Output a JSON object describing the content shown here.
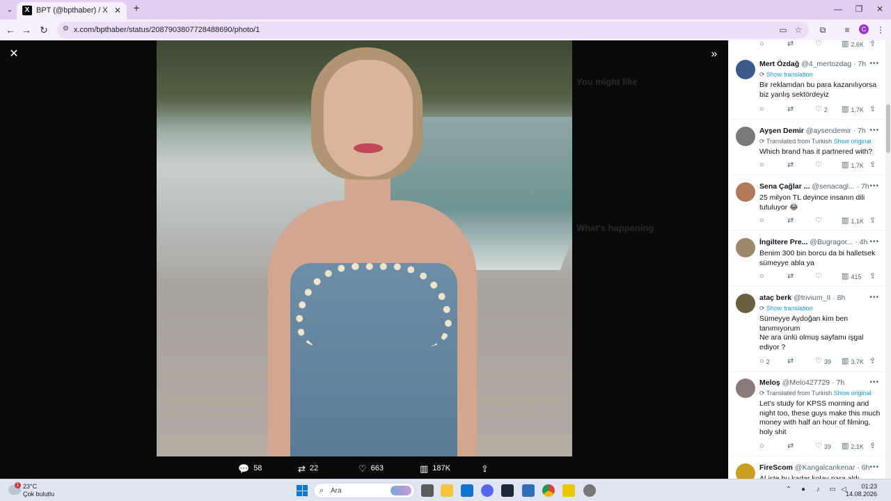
{
  "browser": {
    "tab_title": "BPT (@bpthaber) / X",
    "tab_favicon": "X",
    "url": "x.com/bpthaber/status/2087903807728488690/photo/1",
    "profile_initial": "C"
  },
  "backdrop": {
    "you_might_like": "You might like",
    "whats_happening": "What's happening"
  },
  "media_actions": {
    "replies": "58",
    "reposts": "22",
    "likes": "663",
    "views": "187K"
  },
  "replies": [
    {
      "name": "Mert Özdağ",
      "handle": "@4_mertozdag",
      "time": "· 7h",
      "translation": "Show translation",
      "translation_type": "show",
      "text": "Bir reklamdan bu para kazanılıyorsa biz yanlış sektördeyiz",
      "replies": "",
      "reposts": "",
      "likes": "2",
      "views": "1.7K",
      "avatar_color": "#3b5a8a"
    },
    {
      "name": "Ayşen Demir",
      "handle": "@aysendemir",
      "time": "· 7h",
      "translation": "Translated from Turkish",
      "translation_link": "Show original",
      "translation_type": "translated",
      "text": "Which brand has it partnered with?",
      "replies": "",
      "reposts": "",
      "likes": "",
      "views": "1.7K",
      "avatar_color": "#7a7a7a"
    },
    {
      "name": "Sena Çağlar ...",
      "handle": "@senacagl...",
      "time": "· 7h",
      "translation": "",
      "translation_type": "none",
      "text": "25 milyon TL deyince insanın dili tutuluyor 😂",
      "replies": "",
      "reposts": "",
      "likes": "",
      "views": "1.1K",
      "avatar_color": "#b07a5a"
    },
    {
      "name": "İngiltere Pre...",
      "handle": "@Bugragor...",
      "time": "· 4h",
      "translation": "",
      "translation_type": "none",
      "text": "Benim 300 bin borcu da bi halletsek sümeyye abla ya",
      "replies": "",
      "reposts": "",
      "likes": "",
      "views": "415",
      "avatar_color": "#9a8a6a"
    },
    {
      "name": "ataç berk",
      "handle": "@trivium_II",
      "time": "· 8h",
      "translation": "Show translation",
      "translation_type": "show",
      "text": "Sümeyye Aydoğan kim ben tanımıyorum\nNe ara ünlü olmuş sayfamı işgal ediyor ?",
      "replies": "2",
      "reposts": "",
      "likes": "39",
      "views": "3.7K",
      "avatar_color": "#6a6040"
    },
    {
      "name": "Meloş",
      "handle": "@Melo427729",
      "time": "· 7h",
      "translation": "Translated from Turkish",
      "translation_link": "Show original",
      "translation_type": "translated",
      "text": "Let's study for KPSS morning and night too, these guys make this much money with half an hour of filming, holy shit",
      "replies": "",
      "reposts": "",
      "likes": "39",
      "views": "2.1K",
      "avatar_color": "#8a7a7a"
    },
    {
      "name": "FireScom",
      "handle": "@Kangalcankenar",
      "time": "· 6h",
      "translation": "",
      "translation_type": "none",
      "text": "Al işte bu kadar kolay para aldı",
      "replies": "",
      "reposts": "",
      "likes": "",
      "views": "",
      "avatar_color": "#c8a020"
    }
  ],
  "top_partial_views": "2.6K",
  "taskbar": {
    "temp": "23°C",
    "weather": "Çok bulutlu",
    "search_placeholder": "Ara",
    "time": "01:23",
    "date": "14.08.2026"
  }
}
